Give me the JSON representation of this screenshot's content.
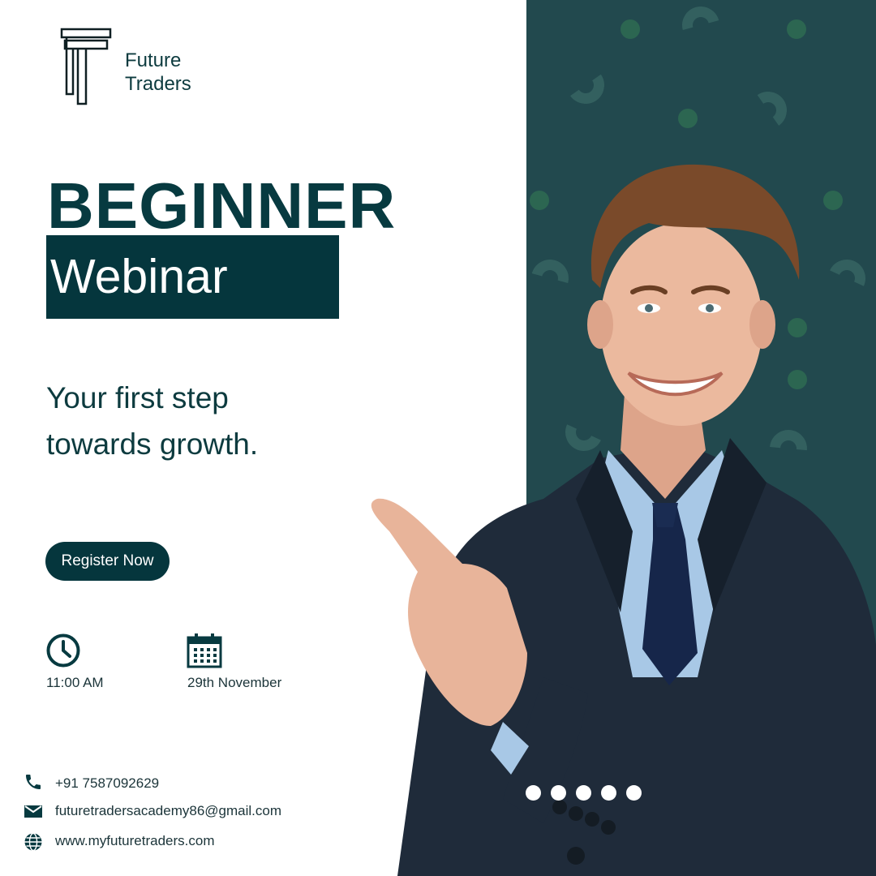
{
  "brand": {
    "logo_icon": "ft-monogram-logo",
    "name_line1": "Future",
    "name_line2": "Traders"
  },
  "hero": {
    "headline": "BEGINNER",
    "subheadline": "Webinar",
    "tagline": "Your first step towards growth."
  },
  "cta": {
    "label": "Register Now"
  },
  "event": {
    "time_icon": "clock-icon",
    "time": "11:00 AM",
    "date_icon": "calendar-icon",
    "date": "29th November"
  },
  "contact": {
    "phone_icon": "phone-icon",
    "phone": "+91 7587092629",
    "email_icon": "mail-icon",
    "email": "futuretradersacademy86@gmail.com",
    "website_icon": "globe-icon",
    "website": "www.myfuturetraders.com"
  },
  "pager": {
    "count": 5
  },
  "colors": {
    "primary": "#05363d",
    "panel": "#22494e",
    "pattern_ring": "#33605f",
    "pattern_dot": "#2c6651",
    "text": "#0d3b3f",
    "background": "#ffffff"
  }
}
